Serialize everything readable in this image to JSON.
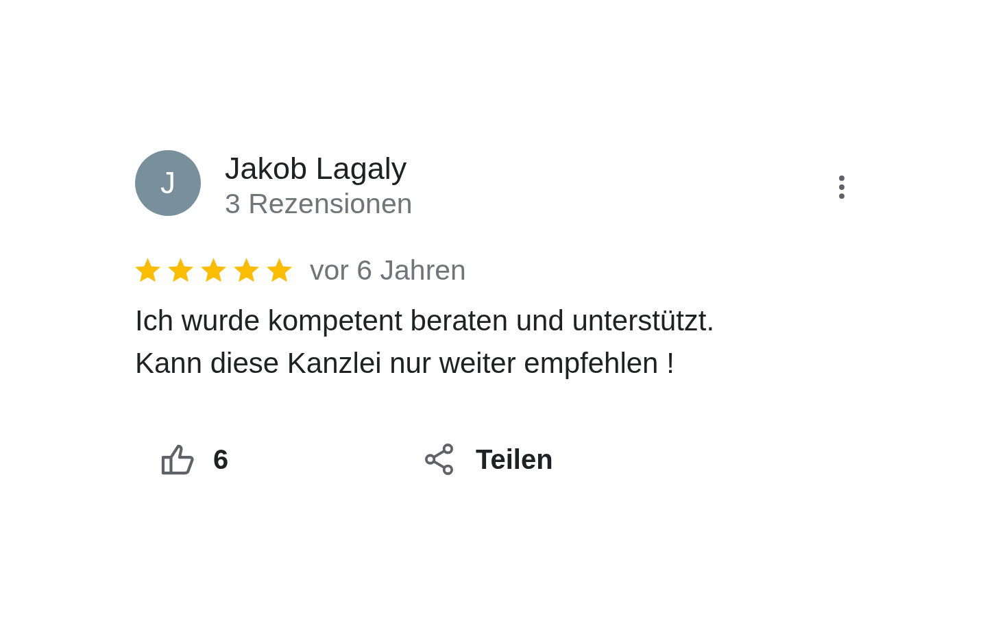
{
  "review": {
    "author": {
      "initial": "J",
      "name": "Jakob Lagaly",
      "review_count": "3 Rezensionen"
    },
    "stars": 5,
    "time": "vor 6 Jahren",
    "text": "Ich wurde kompetent beraten und unterstützt.\nKann diese Kanzlei nur weiter empfehlen !",
    "actions": [
      {
        "kind": "like",
        "label": "6"
      },
      {
        "kind": "share",
        "label": "Teilen"
      }
    ]
  }
}
